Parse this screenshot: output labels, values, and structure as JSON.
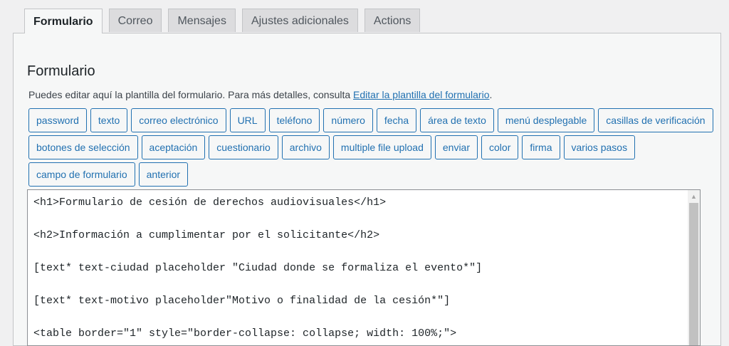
{
  "tabs": [
    {
      "label": "Formulario",
      "active": true
    },
    {
      "label": "Correo",
      "active": false
    },
    {
      "label": "Mensajes",
      "active": false
    },
    {
      "label": "Ajustes adicionales",
      "active": false
    },
    {
      "label": "Actions",
      "active": false
    }
  ],
  "panel": {
    "title": "Formulario",
    "description_prefix": "Puedes editar aquí la plantilla del formulario. Para más detalles, consulta ",
    "description_link": "Editar la plantilla del formulario",
    "description_suffix": "."
  },
  "tag_buttons": [
    [
      "password",
      "texto",
      "correo electrónico",
      "URL",
      "teléfono",
      "número",
      "fecha",
      "área de texto",
      "menú desplegable",
      "casillas de verificación"
    ],
    [
      "botones de selección",
      "aceptación",
      "cuestionario",
      "archivo",
      "multiple file upload",
      "enviar",
      "color",
      "firma",
      "varios pasos"
    ],
    [
      "campo de formulario",
      "anterior"
    ]
  ],
  "editor": {
    "lines": [
      "<h1>Formulario de cesión de derechos audiovisuales</h1>",
      "",
      "<h2>Información a cumplimentar por el solicitante</h2>",
      "",
      "[text* text-ciudad placeholder \"Ciudad donde se formaliza el evento*\"]",
      "",
      "[text* text-motivo placeholder\"Motivo o finalidad de la cesión*\"]",
      "",
      "<table border=\"1\" style=\"border-collapse: collapse; width: 100%;\">"
    ]
  },
  "colors": {
    "accent": "#2271b1",
    "background": "#f0f0f1",
    "panel": "#f6f7f7"
  }
}
